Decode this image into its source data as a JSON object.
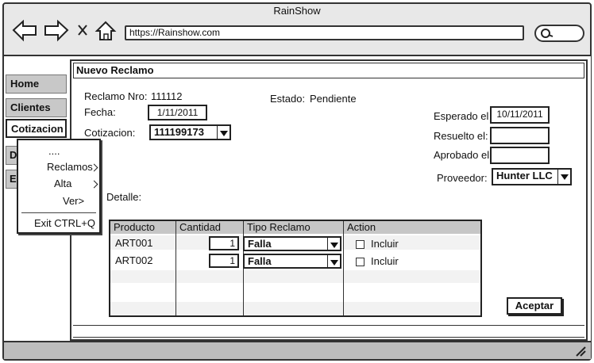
{
  "app": {
    "title": "RainShow",
    "url": "https://Rainshow.com"
  },
  "sidebar": {
    "items": [
      {
        "label": "Home"
      },
      {
        "label": "Clientes"
      },
      {
        "label": "Cotizacion"
      },
      {
        "label": "D"
      },
      {
        "label": "E"
      }
    ]
  },
  "menu": {
    "items": [
      "....",
      "Reclamos",
      "Alta",
      "Ver>"
    ],
    "exit_label": "Exit CTRL+Q"
  },
  "form": {
    "title": "Nuevo Reclamo",
    "reclamo_nro_label": "Reclamo Nro:",
    "reclamo_nro_value": "111112",
    "estado_label": "Estado:",
    "estado_value": "Pendiente",
    "fecha_label": "Fecha:",
    "fecha_value": "1/11/2011",
    "cotizacion_label": "Cotizacion:",
    "cotizacion_value": "111199173",
    "esperado_label": "Esperado el",
    "esperado_value": "10/11/2011",
    "resuelto_label": "Resuelto el:",
    "resuelto_value": "",
    "aprobado_label": "Aprobado el:",
    "aprobado_value": "",
    "proveedor_label": "Proveedor:",
    "proveedor_value": "Hunter LLC",
    "detalle_label": "Detalle:",
    "accept_label": "Aceptar"
  },
  "table": {
    "headers": [
      "Producto",
      "Cantidad",
      "Tipo Reclamo",
      "Action"
    ],
    "rows": [
      {
        "producto": "ART001",
        "cantidad": "1",
        "tipo": "Falla",
        "action": "Incluir"
      },
      {
        "producto": "ART002",
        "cantidad": "1",
        "tipo": "Falla",
        "action": "Incluir"
      }
    ]
  }
}
